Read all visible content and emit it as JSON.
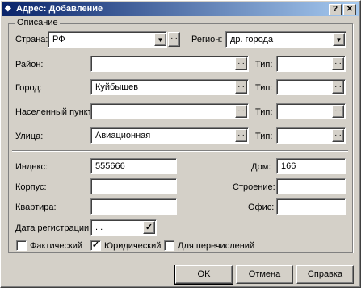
{
  "window": {
    "title": "Адрес: Добавление",
    "help_glyph": "?",
    "close_glyph": "✕",
    "title_icon_glyph": "◆"
  },
  "group": {
    "legend": "Описание"
  },
  "country": {
    "label": "Страна:",
    "value": "РФ"
  },
  "region": {
    "label": "Регион:",
    "value": "др. города"
  },
  "rows": {
    "district": {
      "label": "Район:",
      "value": "",
      "type_label": "Тип:",
      "type_value": ""
    },
    "city": {
      "label": "Город:",
      "value": "Куйбышев",
      "type_label": "Тип:",
      "type_value": ""
    },
    "locality": {
      "label": "Населенный пункт:",
      "value": "",
      "type_label": "Тип:",
      "type_value": ""
    },
    "street": {
      "label": "Улица:",
      "value": "Авиационная",
      "type_label": "Тип:",
      "type_value": ""
    }
  },
  "index": {
    "label": "Индекс:",
    "value": "555666"
  },
  "house": {
    "label": "Дом:",
    "value": "166"
  },
  "korpus": {
    "label": "Корпус:",
    "value": ""
  },
  "building": {
    "label": "Строение:",
    "value": ""
  },
  "apartment": {
    "label": "Квартира:",
    "value": ""
  },
  "office": {
    "label": "Офис:",
    "value": ""
  },
  "reg_date": {
    "label": "Дата регистрации",
    "value": " .  ."
  },
  "checkboxes": {
    "actual": {
      "label": "Фактический",
      "checked": false
    },
    "legal": {
      "label": "Юридический",
      "checked": true
    },
    "transfers": {
      "label": "Для перечислений",
      "checked": false
    }
  },
  "buttons": {
    "ok": "OK",
    "cancel": "Отмена",
    "help": "Справка"
  },
  "glyphs": {
    "ellipsis": "...",
    "dropdown": "▼",
    "check": "✓"
  }
}
